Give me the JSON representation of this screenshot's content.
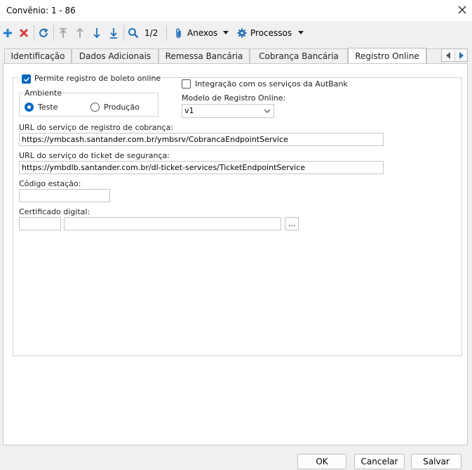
{
  "window": {
    "title": "Convênio: 1 - 86"
  },
  "toolbar": {
    "page_indicator": "1/2",
    "anexos_label": "Anexos",
    "processos_label": "Processos"
  },
  "tabs": [
    {
      "label": "Identificação"
    },
    {
      "label": "Dados Adicionais"
    },
    {
      "label": "Remessa Bancária"
    },
    {
      "label": "Cobrança Bancária"
    },
    {
      "label": "Registro Online",
      "active": true
    }
  ],
  "form": {
    "permite_registro_label": "Permite registro de boleto online",
    "permite_registro_checked": true,
    "ambiente_label": "Ambiente",
    "ambiente_options": [
      "Teste",
      "Produção"
    ],
    "ambiente_selected": "Teste",
    "integracao_label": "Integração com os serviços da AutBank",
    "integracao_checked": false,
    "modelo_label": "Modelo de Registro Online:",
    "modelo_value": "v1",
    "url_cobranca_label": "URL do serviço de registro de cobrança:",
    "url_cobranca_value": "https://ymbcash.santander.com.br/ymbsrv/CobrancaEndpointService",
    "url_ticket_label": "URL do serviço do ticket de segurança:",
    "url_ticket_value": "https://ymbdlb.santander.com.br/dl-ticket-services/TicketEndpointService",
    "codigo_estacao_label": "Código estação:",
    "codigo_estacao_value": "",
    "certificado_label": "Certificado digital:",
    "certificado_code": "",
    "certificado_path": "",
    "browse_label": "..."
  },
  "footer": {
    "ok_label": "OK",
    "cancel_label": "Cancelar",
    "save_label": "Salvar"
  },
  "colors": {
    "accent": "#0067c0",
    "add_icon": "#1f7bd6",
    "delete_icon": "#d83b3b",
    "toolbar_icon": "#1f6fb8",
    "disabled_icon": "#a0a0a0"
  }
}
